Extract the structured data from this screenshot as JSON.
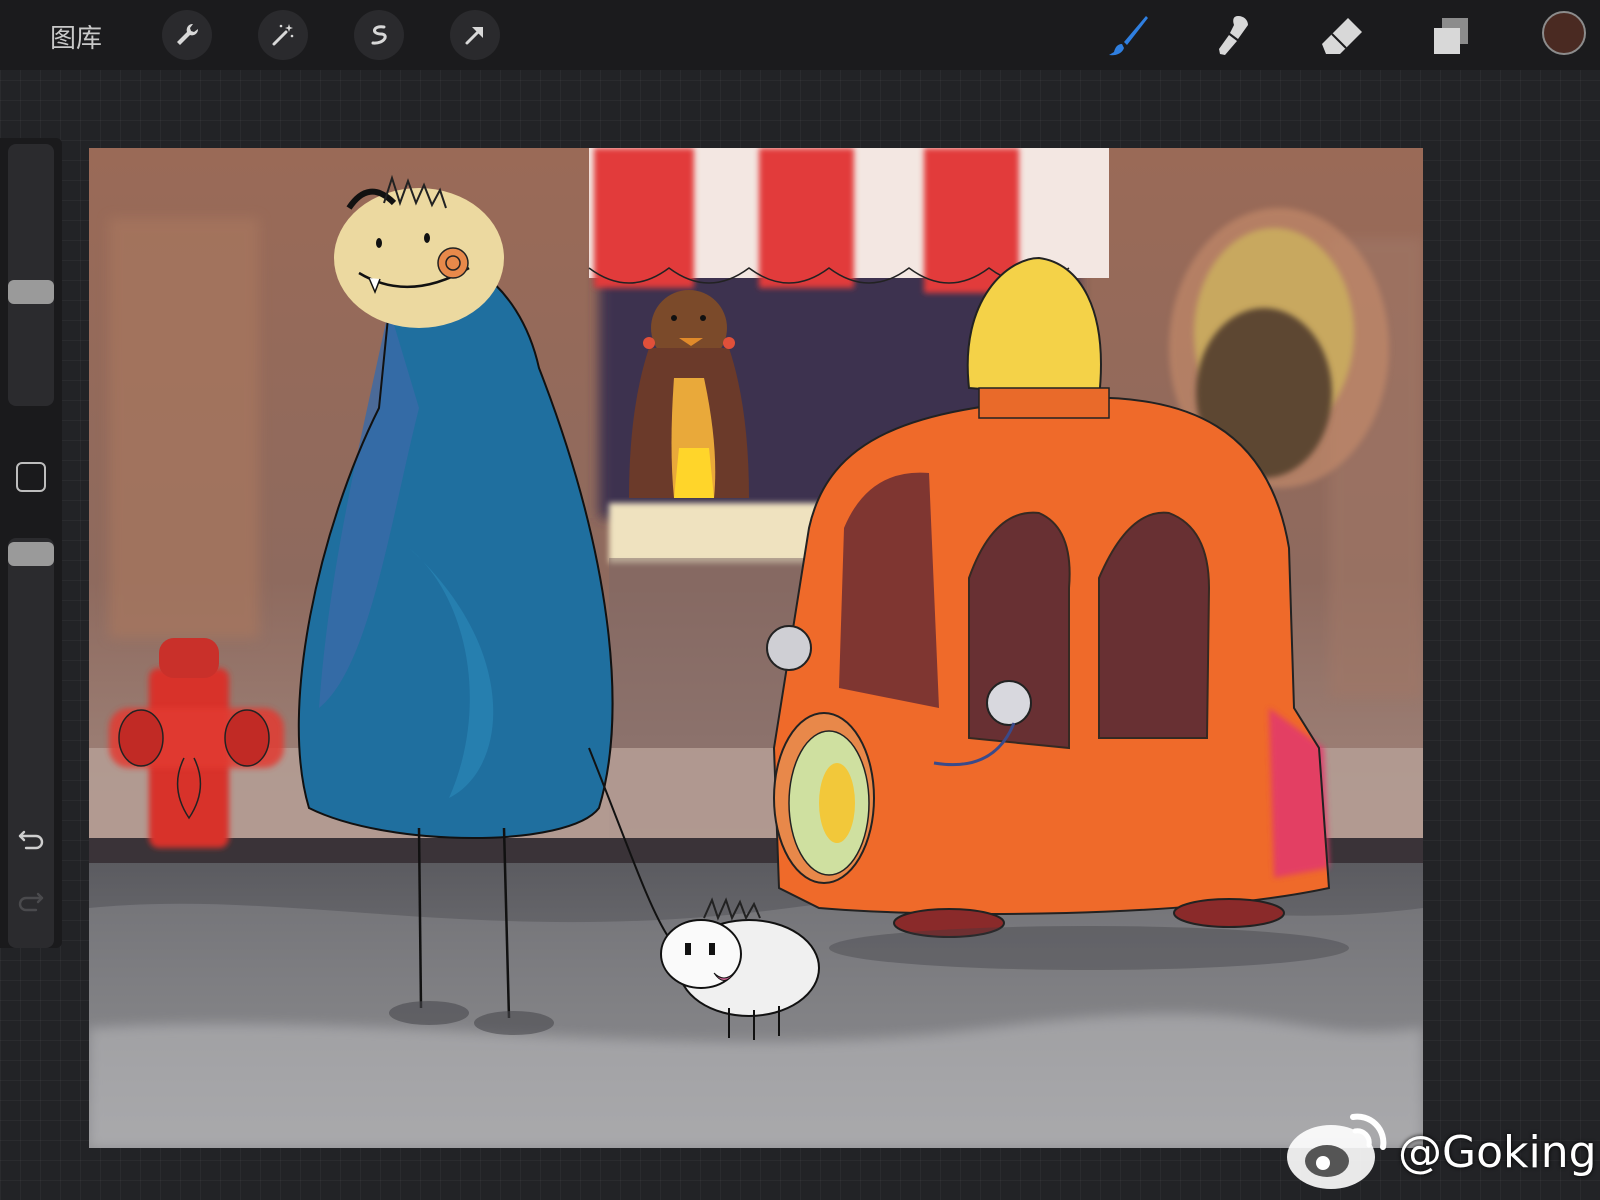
{
  "app": {
    "gallery_label": "图库",
    "current_color": "#4a2a22",
    "active_tool_color": "#2f7fe0"
  },
  "toolbar": {
    "left_tools": [
      "wrench-icon",
      "magic-wand-icon",
      "selection-icon",
      "transform-arrow-icon"
    ],
    "right_tools": [
      "brush-icon",
      "smudge-icon",
      "eraser-icon",
      "layers-icon"
    ]
  },
  "watermark": {
    "handle": "@Goking"
  }
}
